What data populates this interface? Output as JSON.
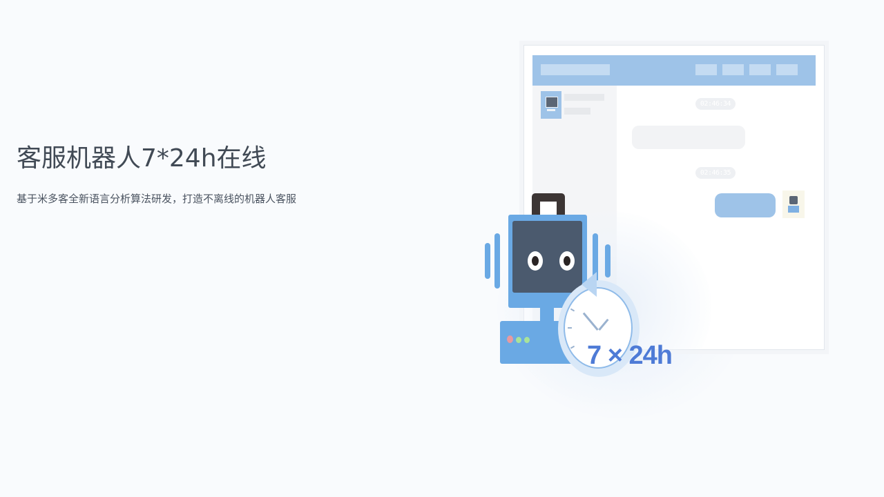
{
  "hero": {
    "title": "客服机器人7*24h在线",
    "subtitle": "基于米多客全新语言分析算法研发，打造不离线的机器人客服"
  },
  "chat_window": {
    "timestamps": [
      "02:46:34",
      "02:46:35"
    ]
  },
  "badge": {
    "text": "7 × 24h"
  },
  "colors": {
    "accent": "#6aa9e4",
    "titlebar": "#9ec3e8",
    "robot_face": "#4b5a6e",
    "badge_text": "#4e7bd6",
    "title_text": "#414a55"
  },
  "icons": {
    "robot": "robot-icon",
    "clock": "clock-icon",
    "contact_avatar": "monitor-icon",
    "bot_avatar": "robot-avatar-icon"
  }
}
